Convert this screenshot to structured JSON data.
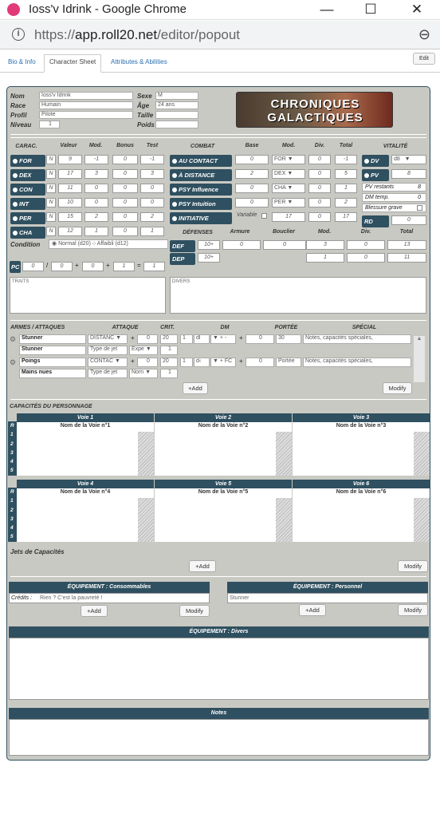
{
  "window": {
    "title": "Ioss'v Idrink - Google Chrome",
    "minimize": "—",
    "maximize": "☐",
    "close": "✕"
  },
  "browser": {
    "url_scheme": "https://",
    "url_host": "app.roll20.net",
    "url_path": "/editor/popout",
    "info_icon": "i",
    "zoom_icon": "⊖"
  },
  "tabs": [
    "Bio & Info",
    "Character Sheet",
    "Attributes & Abilities"
  ],
  "edit_label": "Edit",
  "identity": {
    "nom_label": "Nom",
    "nom": "Ioss'v Idrink",
    "race_label": "Race",
    "race": "Humain",
    "profil_label": "Profil",
    "profil": "Pilote",
    "niveau_label": "Niveau",
    "niveau": "1",
    "sexe_label": "Sexe",
    "sexe": "M",
    "age_label": "Âge",
    "age": "24 ans",
    "taille_label": "Taille",
    "poids_label": "Poids"
  },
  "logo": {
    "line1": "CHRONIQUES",
    "line2": "GALACTIQUES"
  },
  "carac": {
    "title": "CARAC.",
    "valeur": "Valeur",
    "mod": "Mod.",
    "bonus": "Bonus",
    "test": "Test",
    "rows": [
      {
        "name": "FOR",
        "nn": "N N",
        "valeur": "9",
        "mod": "-1",
        "bonus": "0",
        "test": "-1"
      },
      {
        "name": "DEX",
        "nn": "N N",
        "valeur": "17",
        "mod": "3",
        "bonus": "0",
        "test": "3"
      },
      {
        "name": "CON",
        "nn": "N N",
        "valeur": "11",
        "mod": "0",
        "bonus": "0",
        "test": "0"
      },
      {
        "name": "INT",
        "nn": "N N",
        "valeur": "10",
        "mod": "0",
        "bonus": "0",
        "test": "0"
      },
      {
        "name": "PER",
        "nn": "N N",
        "valeur": "15",
        "mod": "2",
        "bonus": "0",
        "test": "2"
      },
      {
        "name": "CHA",
        "nn": "N N",
        "valeur": "12",
        "mod": "1",
        "bonus": "0",
        "test": "1"
      }
    ]
  },
  "condition": {
    "label": "Condition",
    "normal": "Normal (d20)",
    "affaibli": "Affaibli (d12)"
  },
  "combat": {
    "title": "COMBAT",
    "base": "Base",
    "mod": "Mod.",
    "div": "Div.",
    "total": "Total",
    "rows": [
      {
        "name": "AU CONTACT",
        "base": "0",
        "mod": "FOR",
        "div": "0",
        "total": "-1"
      },
      {
        "name": "À DISTANCE",
        "base": "2",
        "mod": "DEX",
        "div": "0",
        "total": "5"
      },
      {
        "name": "PSY Influence",
        "base": "0",
        "mod": "CHA",
        "div": "0",
        "total": "1"
      },
      {
        "name": "PSY Intuition",
        "base": "0",
        "mod": "PER",
        "div": "0",
        "total": "2"
      }
    ],
    "initiative": {
      "name": "INITIATIVE",
      "variable": "Variable",
      "mod": "17",
      "div": "0",
      "total": "17"
    }
  },
  "vitalite": {
    "title": "VITALITÉ",
    "dv_label": "DV",
    "dv": "d8",
    "pv_label": "PV",
    "pv": "8",
    "pv_restants_label": "PV restants",
    "pv_restants": "8",
    "dm_temp_label": "DM temp.",
    "dm_temp": "0",
    "blessure_label": "Blessure grave",
    "rd_label": "RD",
    "rd": "0"
  },
  "defenses": {
    "title": "DÉFENSES",
    "armure": "Armure",
    "bouclier": "Bouclier",
    "mod": "Mod.",
    "div": "Div.",
    "total": "Total",
    "def": {
      "label": "DEF",
      "base": "10+",
      "armure": "0",
      "bouclier": "0",
      "mod": "3",
      "div": "0",
      "total": "13"
    },
    "dep": {
      "label": "DEP",
      "base": "10+",
      "mod": "1",
      "div": "0",
      "total": "11"
    }
  },
  "pc": {
    "label": "PC",
    "a": "0",
    "b": "0",
    "c": "0",
    "d": "1",
    "e": "1",
    "slash": "/",
    "plus1": "+",
    "plus2": "+",
    "eq": "="
  },
  "traits_label": "TRAITS",
  "divers_label": "DIVERS",
  "armes": {
    "title": "ARMES / ATTAQUES",
    "attaque": "ATTAQUE",
    "crit": "CRIT.",
    "dm": "DM",
    "portee": "PORTÉE",
    "special": "SPÉCIAL",
    "rows": [
      {
        "name": "Stunner",
        "attaque": "DISTANC ▼",
        "plus": "+",
        "bonus": "0",
        "crit": "20",
        "dm_n": "1",
        "dm_d": "dl",
        "dm_stat": "▼ + -",
        "dm_plus": "+",
        "dm_bonus": "0",
        "portee": "30",
        "special": "Notes, capacités spéciales,",
        "sub_name": "Stunner",
        "sub_type": "Type de jet",
        "sub_sel": "Expe ▼",
        "sub_n": "1"
      },
      {
        "name": "Poings",
        "attaque": "CONTAC ▼",
        "plus": "+",
        "bonus": "0",
        "crit": "20",
        "dm_n": "1",
        "dm_d": "d‹",
        "dm_stat": "▼ + FC",
        "dm_plus": "+",
        "dm_bonus": "0",
        "portee": "Portée",
        "special": "Notes, capacités spéciales,",
        "sub_name": "Mains nues",
        "sub_type": "Type de jet",
        "sub_sel": "Norn ▼",
        "sub_n": "1"
      }
    ],
    "add": "+Add",
    "modify": "Modify"
  },
  "capacites": {
    "title": "CAPACITÉS DU PERSONNAGE",
    "rows": [
      "R",
      "1",
      "2",
      "3",
      "4",
      "5"
    ],
    "voies": [
      {
        "head": "Voie 1",
        "name": "Nom de la Voie n°1"
      },
      {
        "head": "Voie 2",
        "name": "Nom de la Voie n°2"
      },
      {
        "head": "Voie 3",
        "name": "Nom de la Voie n°3"
      },
      {
        "head": "Voie 4",
        "name": "Nom de la Voie n°4"
      },
      {
        "head": "Voie 5",
        "name": "Nom de la Voie n°5"
      },
      {
        "head": "Voie 6",
        "name": "Nom de la Voie n°6"
      }
    ],
    "jets": "Jets de Capacités",
    "add": "+Add",
    "modify": "Modify"
  },
  "equipement": {
    "consommables": "ÉQUIPEMENT : Consommables",
    "credits_label": "Crédits :",
    "credits": "Rien ? C'est la pauvreté !",
    "personnel": "ÉQUIPEMENT : Personnel",
    "personnel_item": "Stunner",
    "divers": "ÉQUIPEMENT : Divers",
    "add": "+Add",
    "modify": "Modify"
  },
  "notes": "Notes",
  "colors": {
    "accent": "#2f5060",
    "sheet": "#c9c9c3"
  }
}
